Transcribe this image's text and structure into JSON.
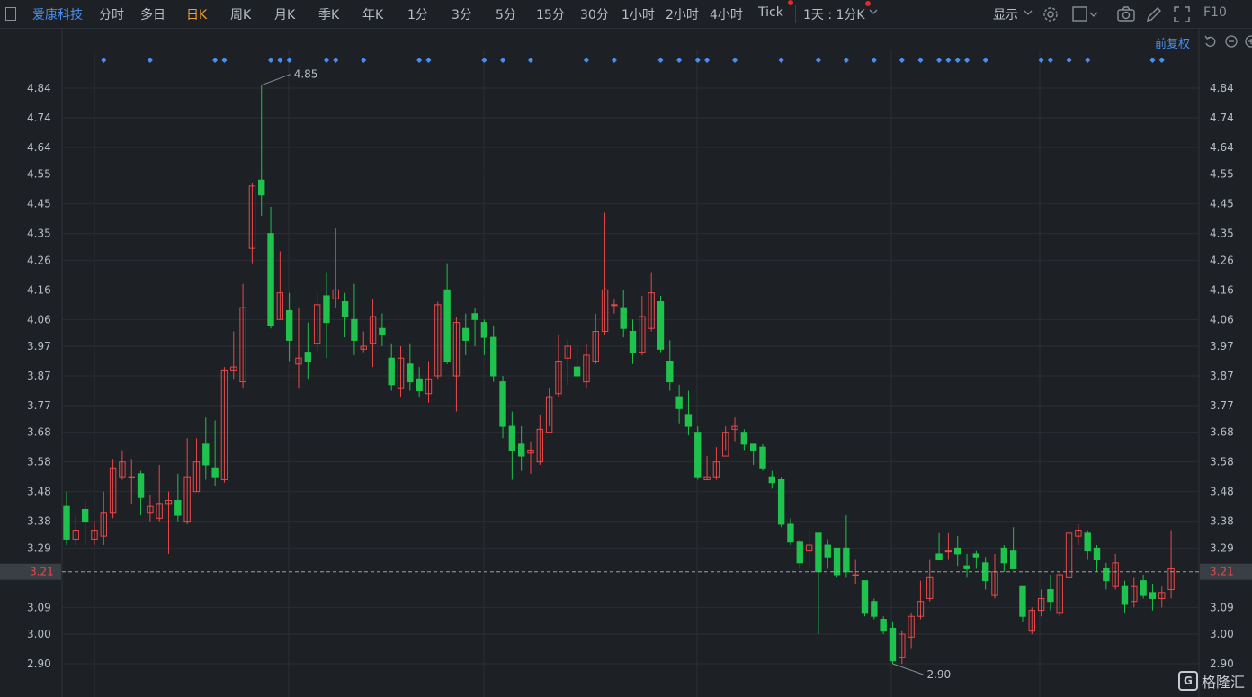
{
  "toolbar": {
    "stock_name": "爱康科技",
    "periods": [
      "分时",
      "多日",
      "日K",
      "周K",
      "月K",
      "季K",
      "年K",
      "1分",
      "3分",
      "5分",
      "15分",
      "30分",
      "1小时",
      "2小时",
      "4小时",
      "Tick"
    ],
    "active_period": "日K",
    "interval_select": "1天 : 1分K",
    "display_label": "显示",
    "f10_label": "F10"
  },
  "adjust_label": "前复权",
  "logo_text": "格隆汇",
  "colors": {
    "up": "#e8484a",
    "down": "#1ec24c",
    "marker": "#4a8ff0",
    "grid": "#2a2e34",
    "last_price_line": "#9aa0a6",
    "last_price_badge": "#3a3f46"
  },
  "chart_data": {
    "type": "candlestick",
    "ylim": [
      2.85,
      4.95
    ],
    "y_ticks": [
      "4.84",
      "4.74",
      "4.64",
      "4.55",
      "4.45",
      "4.35",
      "4.26",
      "4.16",
      "4.06",
      "3.97",
      "3.87",
      "3.77",
      "3.68",
      "3.58",
      "3.48",
      "3.38",
      "3.29",
      "3.09",
      "3.00",
      "2.90"
    ],
    "last_price": "3.21",
    "high_annotation": "4.85",
    "low_annotation": "2.90",
    "candles": [
      [
        3.43,
        3.32,
        3.48,
        3.3
      ],
      [
        3.32,
        3.35,
        3.4,
        3.3
      ],
      [
        3.42,
        3.38,
        3.45,
        3.3
      ],
      [
        3.32,
        3.35,
        3.38,
        3.3
      ],
      [
        3.33,
        3.41,
        3.48,
        3.3
      ],
      [
        3.41,
        3.56,
        3.59,
        3.39
      ],
      [
        3.53,
        3.58,
        3.62,
        3.52
      ],
      [
        3.53,
        3.53,
        3.59,
        3.44
      ],
      [
        3.54,
        3.46,
        3.55,
        3.4
      ],
      [
        3.41,
        3.43,
        3.47,
        3.38
      ],
      [
        3.39,
        3.44,
        3.57,
        3.38
      ],
      [
        3.44,
        3.45,
        3.48,
        3.27
      ],
      [
        3.45,
        3.4,
        3.54,
        3.38
      ],
      [
        3.38,
        3.53,
        3.66,
        3.37
      ],
      [
        3.48,
        3.58,
        3.66,
        3.48
      ],
      [
        3.64,
        3.57,
        3.73,
        3.52
      ],
      [
        3.56,
        3.53,
        3.72,
        3.5
      ],
      [
        3.52,
        3.89,
        3.9,
        3.51
      ],
      [
        3.89,
        3.9,
        4.02,
        3.86
      ],
      [
        3.85,
        4.1,
        4.18,
        3.83
      ],
      [
        4.3,
        4.51,
        4.52,
        4.25
      ],
      [
        4.53,
        4.48,
        4.85,
        4.41
      ],
      [
        4.35,
        4.04,
        4.44,
        4.03
      ],
      [
        4.06,
        4.15,
        4.29,
        4.06
      ],
      [
        4.09,
        3.99,
        4.15,
        3.92
      ],
      [
        3.91,
        3.93,
        4.1,
        3.83
      ],
      [
        3.95,
        3.92,
        4.05,
        3.86
      ],
      [
        3.98,
        4.11,
        4.15,
        3.95
      ],
      [
        4.14,
        4.05,
        4.22,
        3.93
      ],
      [
        4.13,
        4.16,
        4.37,
        4.1
      ],
      [
        4.12,
        4.07,
        4.15,
        4.0
      ],
      [
        4.06,
        3.99,
        4.18,
        3.94
      ],
      [
        3.96,
        3.97,
        4.02,
        3.95
      ],
      [
        3.98,
        4.07,
        4.13,
        3.9
      ],
      [
        4.03,
        4.01,
        4.08,
        3.97
      ],
      [
        3.93,
        3.84,
        3.98,
        3.82
      ],
      [
        3.83,
        3.93,
        3.97,
        3.8
      ],
      [
        3.91,
        3.85,
        3.98,
        3.82
      ],
      [
        3.86,
        3.82,
        3.9,
        3.8
      ],
      [
        3.81,
        3.86,
        3.92,
        3.78
      ],
      [
        3.87,
        4.11,
        4.12,
        3.86
      ],
      [
        4.16,
        3.92,
        4.25,
        3.91
      ],
      [
        3.87,
        4.05,
        4.07,
        3.75
      ],
      [
        4.03,
        3.99,
        4.08,
        3.94
      ],
      [
        4.08,
        4.06,
        4.1,
        3.97
      ],
      [
        4.05,
        4.0,
        4.06,
        3.94
      ],
      [
        4.0,
        3.87,
        4.04,
        3.85
      ],
      [
        3.85,
        3.7,
        3.87,
        3.66
      ],
      [
        3.7,
        3.62,
        3.75,
        3.52
      ],
      [
        3.64,
        3.6,
        3.7,
        3.55
      ],
      [
        3.61,
        3.62,
        3.65,
        3.54
      ],
      [
        3.58,
        3.69,
        3.74,
        3.57
      ],
      [
        3.68,
        3.8,
        3.83,
        3.7
      ],
      [
        3.81,
        3.92,
        4.01,
        3.8
      ],
      [
        3.93,
        3.97,
        3.99,
        3.84
      ],
      [
        3.9,
        3.87,
        3.97,
        3.86
      ],
      [
        3.85,
        3.94,
        3.98,
        3.83
      ],
      [
        3.92,
        4.02,
        4.08,
        3.91
      ],
      [
        4.02,
        4.16,
        4.42,
        4.01
      ],
      [
        4.11,
        4.11,
        4.13,
        4.08
      ],
      [
        4.1,
        4.03,
        4.16,
        4.0
      ],
      [
        4.02,
        3.95,
        4.06,
        3.91
      ],
      [
        3.95,
        4.07,
        4.14,
        3.94
      ],
      [
        4.03,
        4.15,
        4.22,
        4.02
      ],
      [
        4.12,
        3.96,
        4.14,
        3.95
      ],
      [
        3.92,
        3.85,
        3.99,
        3.82
      ],
      [
        3.8,
        3.76,
        3.84,
        3.71
      ],
      [
        3.74,
        3.7,
        3.82,
        3.67
      ],
      [
        3.68,
        3.53,
        3.7,
        3.52
      ],
      [
        3.52,
        3.53,
        3.6,
        3.52
      ],
      [
        3.53,
        3.58,
        3.63,
        3.52
      ],
      [
        3.6,
        3.68,
        3.7,
        3.62
      ],
      [
        3.69,
        3.7,
        3.73,
        3.65
      ],
      [
        3.68,
        3.64,
        3.69,
        3.62
      ],
      [
        3.64,
        3.62,
        3.64,
        3.57
      ],
      [
        3.63,
        3.56,
        3.64,
        3.55
      ],
      [
        3.53,
        3.51,
        3.55,
        3.49
      ],
      [
        3.52,
        3.37,
        3.53,
        3.36
      ],
      [
        3.37,
        3.31,
        3.39,
        3.3
      ],
      [
        3.31,
        3.24,
        3.32,
        3.22
      ],
      [
        3.28,
        3.3,
        3.35,
        3.22
      ],
      [
        3.34,
        3.21,
        3.34,
        3.0
      ],
      [
        3.3,
        3.26,
        3.32,
        3.22
      ],
      [
        3.29,
        3.2,
        3.29,
        3.19
      ],
      [
        3.29,
        3.21,
        3.4,
        3.19
      ],
      [
        3.2,
        3.2,
        3.25,
        3.17
      ],
      [
        3.18,
        3.07,
        3.18,
        3.06
      ],
      [
        3.11,
        3.06,
        3.12,
        3.05
      ],
      [
        3.05,
        3.01,
        3.06,
        3.0
      ],
      [
        3.02,
        2.91,
        3.04,
        2.9
      ],
      [
        2.92,
        3.0,
        3.01,
        2.9
      ],
      [
        2.99,
        3.06,
        3.07,
        2.95
      ],
      [
        3.06,
        3.11,
        3.18,
        3.05
      ],
      [
        3.12,
        3.19,
        3.25,
        3.11
      ],
      [
        3.27,
        3.25,
        3.34,
        3.25
      ],
      [
        3.28,
        3.28,
        3.34,
        3.25
      ],
      [
        3.29,
        3.27,
        3.33,
        3.23
      ],
      [
        3.23,
        3.22,
        3.27,
        3.19
      ],
      [
        3.27,
        3.26,
        3.28,
        3.22
      ],
      [
        3.24,
        3.18,
        3.26,
        3.15
      ],
      [
        3.13,
        3.21,
        3.27,
        3.12
      ],
      [
        3.29,
        3.24,
        3.3,
        3.21
      ],
      [
        3.28,
        3.22,
        3.36,
        3.22
      ],
      [
        3.16,
        3.06,
        3.16,
        3.04
      ],
      [
        3.01,
        3.08,
        3.09,
        3.0
      ],
      [
        3.08,
        3.12,
        3.15,
        3.06
      ],
      [
        3.15,
        3.11,
        3.2,
        3.08
      ],
      [
        3.07,
        3.2,
        3.21,
        3.06
      ],
      [
        3.19,
        3.34,
        3.36,
        3.18
      ],
      [
        3.33,
        3.35,
        3.37,
        3.3
      ],
      [
        3.34,
        3.28,
        3.35,
        3.25
      ],
      [
        3.29,
        3.25,
        3.3,
        3.21
      ],
      [
        3.22,
        3.18,
        3.24,
        3.15
      ],
      [
        3.16,
        3.24,
        3.27,
        3.15
      ],
      [
        3.16,
        3.1,
        3.18,
        3.07
      ],
      [
        3.11,
        3.16,
        3.19,
        3.09
      ],
      [
        3.18,
        3.13,
        3.2,
        3.12
      ],
      [
        3.14,
        3.12,
        3.17,
        3.08
      ],
      [
        3.12,
        3.14,
        3.16,
        3.09
      ],
      [
        3.15,
        3.22,
        3.35,
        3.12
      ]
    ],
    "marker_indices": [
      4,
      9,
      16,
      17,
      22,
      23,
      24,
      28,
      29,
      32,
      38,
      39,
      45,
      47,
      50,
      56,
      59,
      64,
      66,
      68,
      69,
      72,
      77,
      81,
      84,
      87,
      90,
      92,
      94,
      95,
      96,
      97,
      99,
      105,
      106,
      108,
      110,
      117,
      118
    ]
  }
}
